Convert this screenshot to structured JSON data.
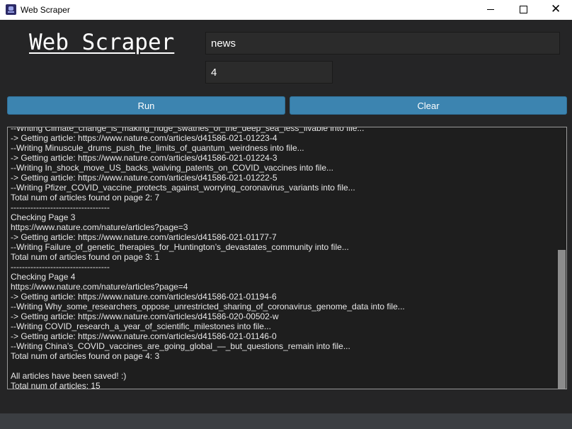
{
  "window": {
    "title": "Web Scraper",
    "minimize_glyph": "",
    "maximize_glyph": "",
    "close_glyph": "✕"
  },
  "header": {
    "title": "Web Scraper"
  },
  "inputs": {
    "search_value": "news",
    "pages_value": "4"
  },
  "buttons": {
    "run_label": "Run",
    "clear_label": "Clear"
  },
  "log": {
    "lines": [
      "--Writing Climate_change_is_making_huge_swathes_of_the_deep_sea_less_livable into file...",
      "-> Getting article: https://www.nature.com/articles/d41586-021-01223-4",
      "--Writing Minuscule_drums_push_the_limits_of_quantum_weirdness into file...",
      "-> Getting article: https://www.nature.com/articles/d41586-021-01224-3",
      "--Writing In_shock_move_US_backs_waiving_patents_on_COVID_vaccines into file...",
      "-> Getting article: https://www.nature.com/articles/d41586-021-01222-5",
      "--Writing Pfizer_COVID_vaccine_protects_against_worrying_coronavirus_variants into file...",
      "Total num of articles found on page 2: 7",
      "-----------------------------------",
      "Checking Page 3",
      "https://www.nature.com/nature/articles?page=3",
      "-> Getting article: https://www.nature.com/articles/d41586-021-01177-7",
      "--Writing Failure_of_genetic_therapies_for_Huntington’s_devastates_community into file...",
      "Total num of articles found on page 3: 1",
      "-----------------------------------",
      "Checking Page 4",
      "https://www.nature.com/nature/articles?page=4",
      "-> Getting article: https://www.nature.com/articles/d41586-021-01194-6",
      "--Writing Why_some_researchers_oppose_unrestricted_sharing_of_coronavirus_genome_data into file...",
      "-> Getting article: https://www.nature.com/articles/d41586-020-00502-w",
      "--Writing COVID_research_a_year_of_scientific_milestones into file...",
      "-> Getting article: https://www.nature.com/articles/d41586-021-01146-0",
      "--Writing China’s_COVID_vaccines_are_going_global_—_but_questions_remain into file...",
      "Total num of articles found on page 4: 3",
      "",
      "All articles have been saved! :)",
      "Total num of articles: 15"
    ]
  },
  "colors": {
    "background": "#252526",
    "button": "#3c84b0",
    "log_background": "#1e1e1e",
    "statusbar": "#3b3e42"
  }
}
